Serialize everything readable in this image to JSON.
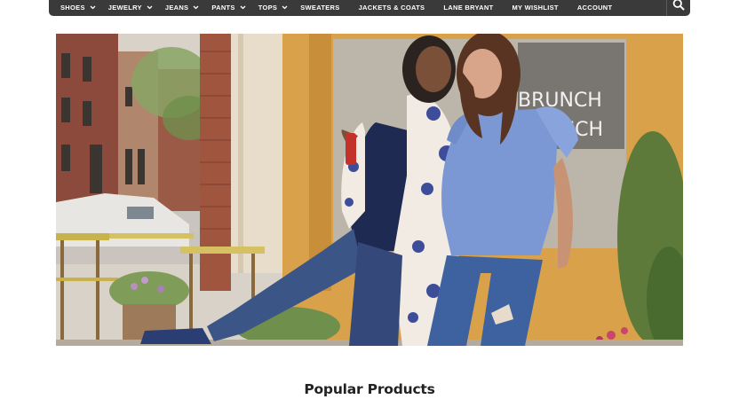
{
  "nav": {
    "items": [
      {
        "label": "SHOES",
        "has_dropdown": true
      },
      {
        "label": "JEWELRY",
        "has_dropdown": true
      },
      {
        "label": "JEANS",
        "has_dropdown": true
      },
      {
        "label": "PANTS",
        "has_dropdown": true
      },
      {
        "label": "TOPS",
        "has_dropdown": true
      },
      {
        "label": "SWEATERS",
        "has_dropdown": false
      },
      {
        "label": "JACKETS & COATS",
        "has_dropdown": false
      },
      {
        "label": "LANE BRYANT",
        "has_dropdown": false
      },
      {
        "label": "MY WISHLIST",
        "has_dropdown": false
      },
      {
        "label": "ACCOUNT",
        "has_dropdown": false
      }
    ],
    "search_icon": "search-icon",
    "bar_color": "#3a3a3a"
  },
  "hero": {
    "storefront_sign_line1": "BRUNCH",
    "storefront_sign_line2": "UCH"
  },
  "section": {
    "title": "Popular Products"
  }
}
